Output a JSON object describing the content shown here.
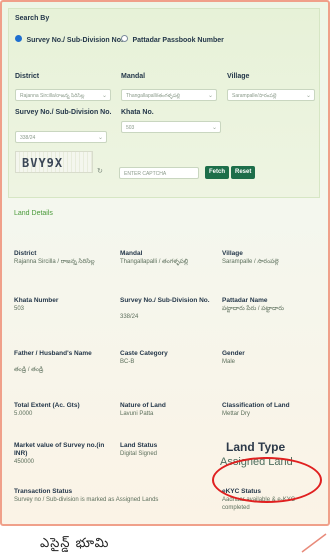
{
  "search": {
    "title": "Search By",
    "option_survey": "Survey No./ Sub-Division No.",
    "option_passbook": "Pattadar Passbook Number",
    "district_label": "District",
    "district_value": "Rajanna Sircilla/రాజన్న సిరిసిల్ల",
    "mandal_label": "Mandal",
    "mandal_value": "Thangallapalli/తంగళ్ళపల్లి",
    "village_label": "Village",
    "village_value": "Sarampalle/సారంపల్లె",
    "survey_label": "Survey No./ Sub-Division No.",
    "survey_value": "338/24",
    "khata_label": "Khata No.",
    "khata_value": "503",
    "captcha_text": "BVY9X",
    "captcha_placeholder": "ENTER CAPTCHA",
    "fetch_label": "Fetch",
    "reset_label": "Reset"
  },
  "details": {
    "section_title": "Land Details",
    "district_label": "District",
    "district_value": "Rajanna Sircilla / రాజన్న సిరిసిల్ల",
    "mandal_label": "Mandal",
    "mandal_value": "Thangallapalli / తంగళ్ళపల్లి",
    "village_label": "Village",
    "village_value": "Sarampalle / సారంపల్లె",
    "khata_label": "Khata Number",
    "khata_value": "503",
    "survey_label": "Survey No./ Sub-Division No.",
    "survey_value": "338/24",
    "pattadar_label": "Pattadar Name",
    "pattadar_value": "పట్టాదారు పేరు / పట్టాదారు",
    "father_label": "Father / Husband's Name",
    "father_value": "తండ్రి / తండ్రి",
    "caste_label": "Caste Category",
    "caste_value": "BC-B",
    "gender_label": "Gender",
    "gender_value": "Male",
    "extent_label": "Total Extent (Ac. Gts)",
    "extent_value": "5.0000",
    "nature_label": "Nature of Land",
    "nature_value": "Lavuni Patta",
    "classification_label": "Classification of Land",
    "classification_value": "Mettar Dry",
    "market_label": "Market value of Survey no.(in INR)",
    "market_value": "450000",
    "status_label": "Land Status",
    "status_value": "Digital Signed",
    "landtype_label": "Land Type",
    "landtype_value": "Assigned Land",
    "transaction_label": "Transaction Status",
    "transaction_value": "Survey no / Sub-division is marked as Assigned Lands",
    "ekyc_label": "eKYC Status",
    "ekyc_value": "Aadhaar available & e-KYC completed"
  },
  "caption": {
    "text": "ఎసైన్డ్ భూమి"
  },
  "colors": {
    "accent": "#1d6e4a",
    "highlight": "#e02020",
    "frame": "#f0a08a"
  }
}
